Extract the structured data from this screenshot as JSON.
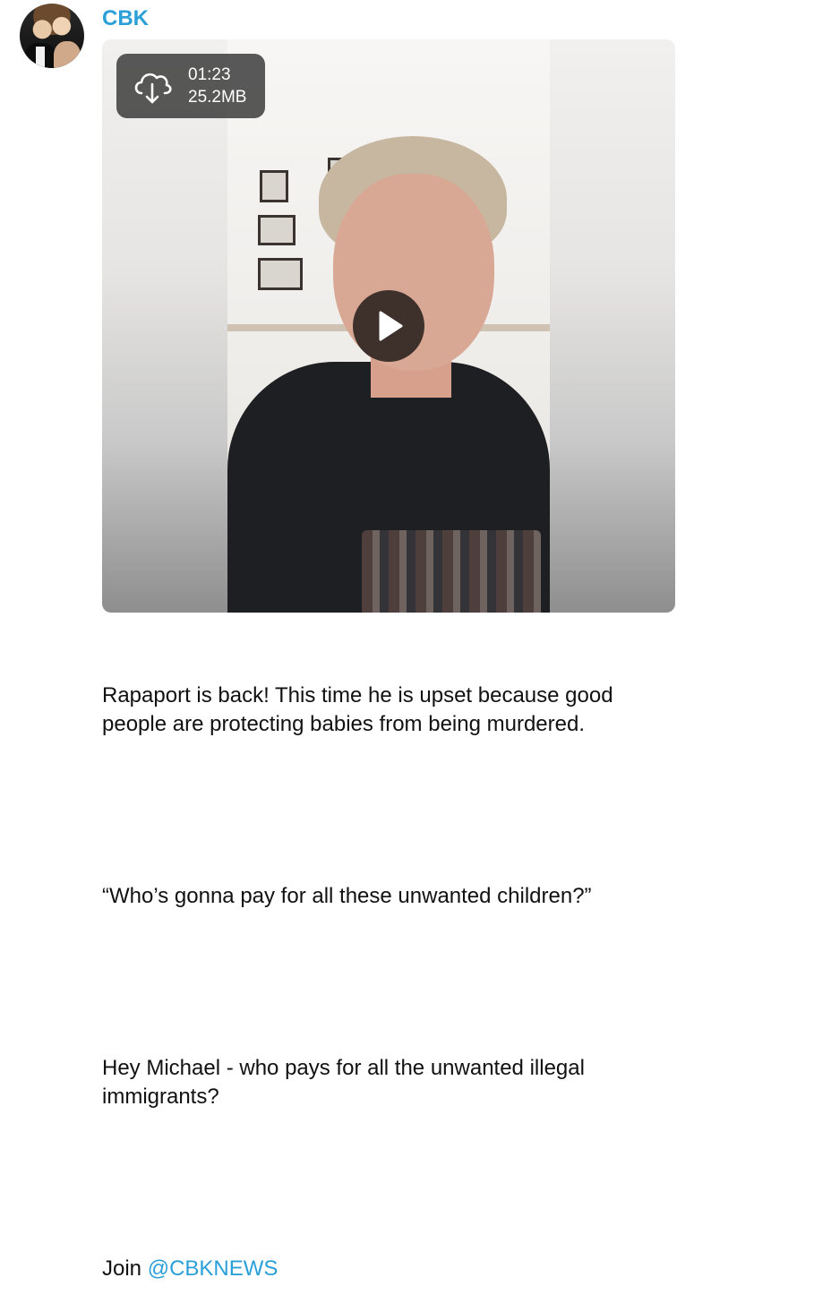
{
  "message": {
    "sender": "CBK",
    "avatar_icon": "profile-photo",
    "video": {
      "duration": "01:23",
      "size": "25.2MB",
      "download_icon": "cloud-download-icon",
      "play_icon": "play-icon"
    },
    "caption": {
      "p1": "Rapaport is back! This time he is upset because good people are protecting babies from being murdered.",
      "p2": "“Who’s gonna pay for all these unwanted children?”",
      "p3": "Hey Michael - who pays for all the unwanted illegal immigrants?",
      "join_prefix": "Join ",
      "join_link": "@CBKNEWS"
    }
  },
  "colors": {
    "accent": "#2a9fd8",
    "text": "#111111",
    "badge_bg": "#3c3c3c"
  }
}
